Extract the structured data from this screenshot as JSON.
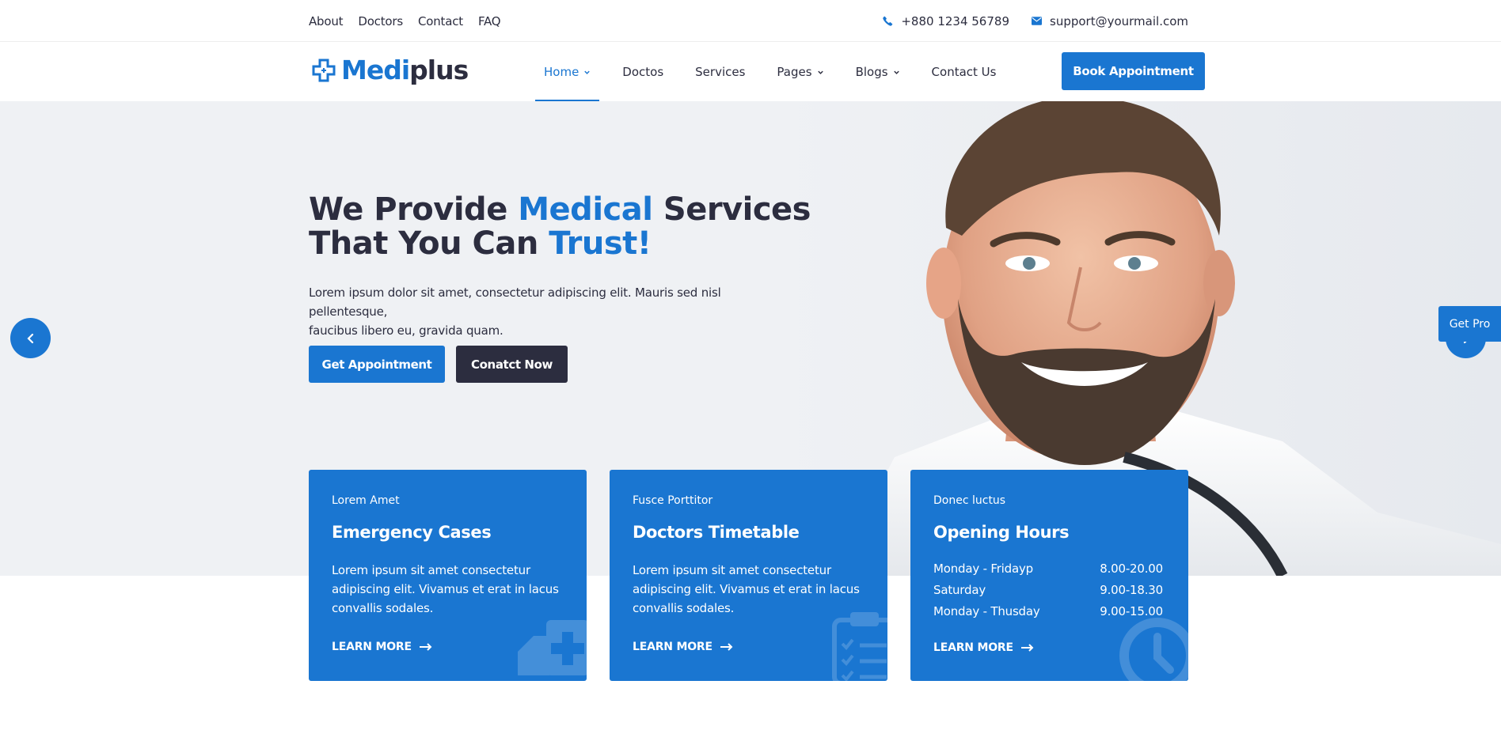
{
  "topbar": {
    "links": [
      "About",
      "Doctors",
      "Contact",
      "FAQ"
    ],
    "phone": "+880 1234 56789",
    "email": "support@yourmail.com"
  },
  "logo": {
    "part1": "Medi",
    "part2": "plus"
  },
  "nav": {
    "items": [
      {
        "label": "Home",
        "dropdown": true,
        "active": true
      },
      {
        "label": "Doctos",
        "dropdown": false
      },
      {
        "label": "Services",
        "dropdown": false
      },
      {
        "label": "Pages",
        "dropdown": true
      },
      {
        "label": "Blogs",
        "dropdown": true
      },
      {
        "label": "Contact Us",
        "dropdown": false
      }
    ],
    "book_label": "Book Appointment"
  },
  "hero": {
    "title_1": "We Provide ",
    "title_hl1": "Medical",
    "title_2": " Services",
    "title_3": "That You Can ",
    "title_hl2": "Trust!",
    "text_line1": "Lorem ipsum dolor sit amet, consectetur adipiscing elit. Mauris sed nisl pellentesque,",
    "text_line2": "faucibus libero eu, gravida quam.",
    "btn_appointment": "Get Appointment",
    "btn_contact": "Conatct Now"
  },
  "getpro": "Get Pro",
  "cards": [
    {
      "sub": "Lorem Amet",
      "title": "Emergency Cases",
      "desc": "Lorem ipsum sit amet consectetur adipiscing elit. Vivamus et erat in lacus convallis sodales.",
      "link": "LEARN MORE"
    },
    {
      "sub": "Fusce Porttitor",
      "title": "Doctors Timetable",
      "desc": "Lorem ipsum sit amet consectetur adipiscing elit. Vivamus et erat in lacus convallis sodales.",
      "link": "LEARN MORE"
    },
    {
      "sub": "Donec luctus",
      "title": "Opening Hours",
      "hours": [
        {
          "day": "Monday - Fridayp",
          "time": "8.00-20.00"
        },
        {
          "day": "Saturday",
          "time": "9.00-18.30"
        },
        {
          "day": "Monday - Thusday",
          "time": "9.00-15.00"
        }
      ],
      "link": "LEARN MORE"
    }
  ],
  "colors": {
    "primary": "#1A76D1",
    "dark": "#2C2D3F",
    "hero_bg": "#EFF1F4"
  },
  "icons": [
    "phone-icon",
    "mail-icon",
    "chevron-down-icon",
    "arrow-left-icon",
    "arrow-right-icon",
    "long-arrow-right-icon",
    "ambulance-icon",
    "clipboard-icon",
    "clock-icon"
  ]
}
